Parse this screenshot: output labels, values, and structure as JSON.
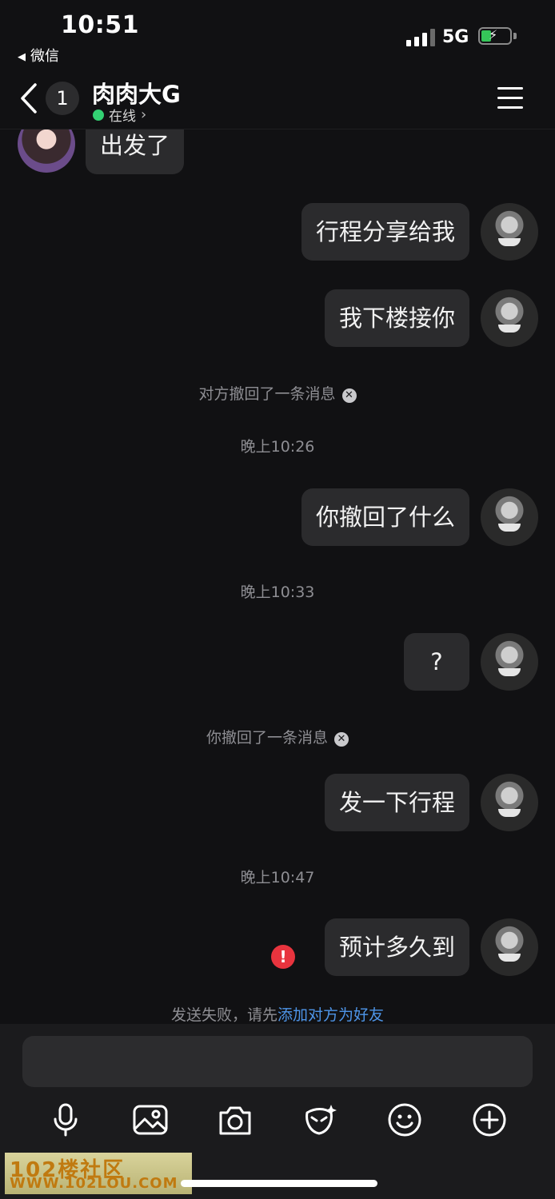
{
  "status_bar": {
    "time": "10:51",
    "back_app": "微信",
    "network": "5G"
  },
  "header": {
    "unread_count": "1",
    "contact_name": "肉肉大G",
    "presence": "在线"
  },
  "messages": {
    "m0": "出发了",
    "m1": "行程分享给我",
    "m2": "我下楼接你",
    "sys_recall_other": "对方撤回了一条消息",
    "time1": "晚上10:26",
    "m3": "你撤回了什么",
    "time2": "晚上10:33",
    "m4": "?",
    "sys_recall_self": "你撤回了一条消息",
    "m5": "发一下行程",
    "time3": "晚上10:47",
    "m6": "预计多久到",
    "send_failed_prefix": "发送失败，请先",
    "send_failed_link": "添加对方为好友"
  },
  "toolbar": {
    "items": [
      "microphone-icon",
      "image-icon",
      "camera-icon",
      "sticker-icon",
      "emoji-icon",
      "add-icon"
    ]
  },
  "watermark": {
    "line1": "102楼社区",
    "line2": "WWW.102LOU.COM"
  },
  "colors": {
    "background": "#111113",
    "bubble": "#2b2b2d",
    "online": "#33d173",
    "link": "#4e95e8",
    "error": "#e8343e"
  }
}
